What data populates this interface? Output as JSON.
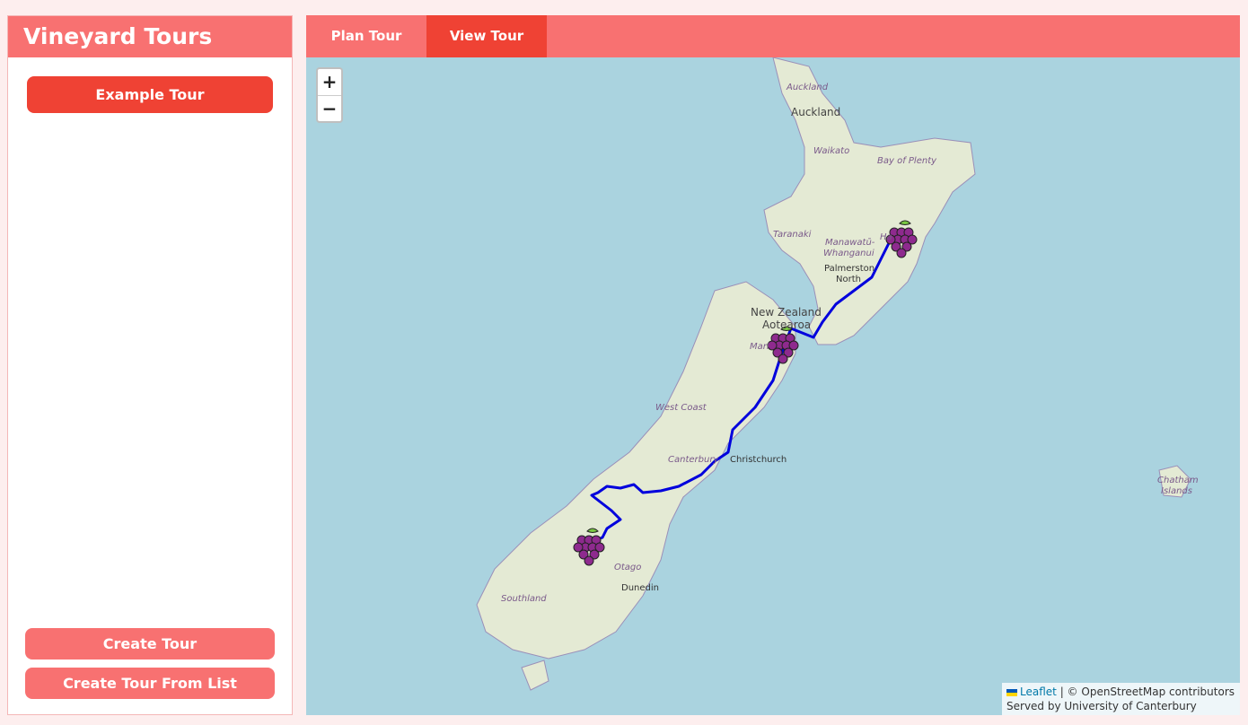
{
  "sidebar": {
    "title": "Vineyard Tours",
    "example_tour_label": "Example Tour",
    "create_tour_label": "Create Tour",
    "create_tour_from_list_label": "Create Tour From List"
  },
  "tabs": {
    "plan_label": "Plan Tour",
    "view_label": "View Tour",
    "active": "View Tour"
  },
  "map": {
    "zoom_in": "+",
    "zoom_out": "−",
    "attribution": {
      "leaflet": "Leaflet",
      "osm": "| © OpenStreetMap contributors",
      "served": "Served by University of Canterbury"
    },
    "labels": {
      "auckland_region": "Auckland",
      "auckland": "Auckland",
      "waikato": "Waikato",
      "bay_of_plenty": "Bay of Plenty",
      "taranaki": "Taranaki",
      "manawatu": "Manawatū-",
      "whanganui": "Whanganui",
      "palmerston1": "Palmerston",
      "palmerston2": "North",
      "hawkes": "Ha",
      "nz1": "New Zealand",
      "nz2": "Aotearoa",
      "marlborough": "Marl",
      "west_coast": "West Coast",
      "canterbury": "Canterbury",
      "christchurch": "Christchurch",
      "otago": "Otago",
      "dunedin": "Dunedin",
      "southland": "Southland",
      "chatham1": "Chatham",
      "chatham2": "Islands"
    },
    "colors": {
      "route": "#0000dd",
      "grape": "#8e2a8e",
      "land": "#e4ead4"
    },
    "markers": [
      "grape-icon",
      "grape-icon",
      "grape-icon"
    ]
  }
}
